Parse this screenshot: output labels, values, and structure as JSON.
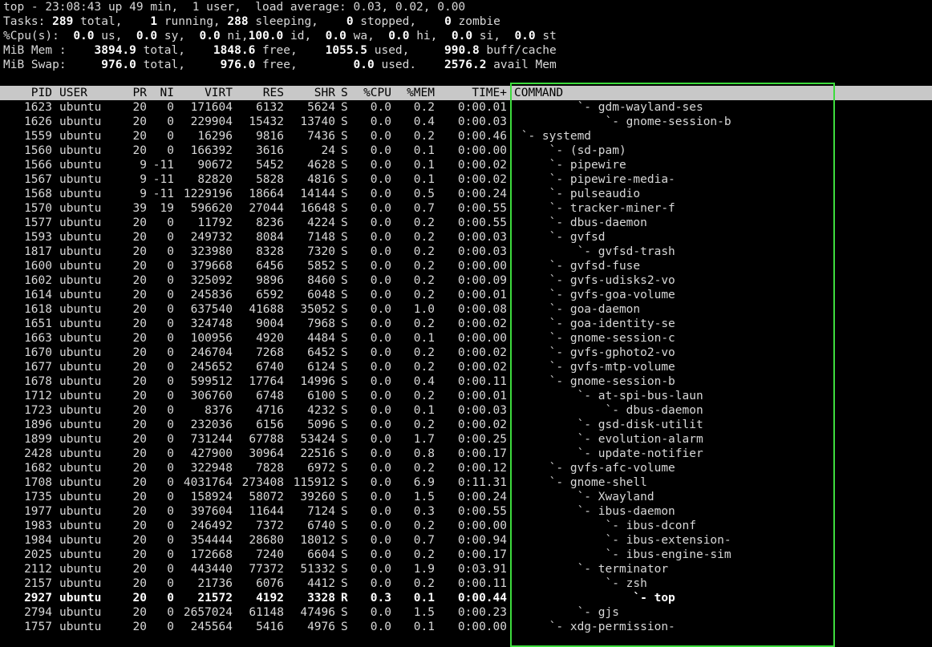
{
  "summary": {
    "top_line": "top - 23:08:43 up 49 min,  1 user,  load average: 0.03, 0.02, 0.00",
    "tasks": {
      "label": "Tasks:",
      "total": "289",
      "running": "1",
      "sleeping": "288",
      "stopped": "0",
      "zombie": "0"
    },
    "cpu": {
      "label": "%Cpu(s):",
      "us": "0.0",
      "sy": "0.0",
      "ni": "0.0",
      "id": "100.0",
      "wa": "0.0",
      "hi": "0.0",
      "si": "0.0",
      "st": "0.0"
    },
    "mem": {
      "label": "MiB Mem :",
      "total": "3894.9",
      "free": "1848.6",
      "used": "1055.5",
      "buff_cache": "990.8"
    },
    "swap": {
      "label": "MiB Swap:",
      "total": "976.0",
      "free": "976.0",
      "used": "0.0",
      "avail": "2576.2"
    }
  },
  "columns": {
    "pid": "PID",
    "user": "USER",
    "pr": "PR",
    "ni": "NI",
    "virt": "VIRT",
    "res": "RES",
    "shr": "SHR",
    "s": "S",
    "cpu": "%CPU",
    "mem": "%MEM",
    "time": "TIME+",
    "command": "COMMAND"
  },
  "processes": [
    {
      "pid": "1623",
      "user": "ubuntu",
      "pr": "20",
      "ni": "0",
      "virt": "171604",
      "res": "6132",
      "shr": "5624",
      "s": "S",
      "cpu": "0.0",
      "mem": "0.2",
      "time": "0:00.01",
      "command": "         `- gdm-wayland-ses"
    },
    {
      "pid": "1626",
      "user": "ubuntu",
      "pr": "20",
      "ni": "0",
      "virt": "229904",
      "res": "15432",
      "shr": "13740",
      "s": "S",
      "cpu": "0.0",
      "mem": "0.4",
      "time": "0:00.03",
      "command": "             `- gnome-session-b"
    },
    {
      "pid": "1559",
      "user": "ubuntu",
      "pr": "20",
      "ni": "0",
      "virt": "16296",
      "res": "9816",
      "shr": "7436",
      "s": "S",
      "cpu": "0.0",
      "mem": "0.2",
      "time": "0:00.46",
      "command": " `- systemd"
    },
    {
      "pid": "1560",
      "user": "ubuntu",
      "pr": "20",
      "ni": "0",
      "virt": "166392",
      "res": "3616",
      "shr": "24",
      "s": "S",
      "cpu": "0.0",
      "mem": "0.1",
      "time": "0:00.00",
      "command": "     `- (sd-pam)"
    },
    {
      "pid": "1566",
      "user": "ubuntu",
      "pr": "9",
      "ni": "-11",
      "virt": "90672",
      "res": "5452",
      "shr": "4628",
      "s": "S",
      "cpu": "0.0",
      "mem": "0.1",
      "time": "0:00.02",
      "command": "     `- pipewire"
    },
    {
      "pid": "1567",
      "user": "ubuntu",
      "pr": "9",
      "ni": "-11",
      "virt": "82820",
      "res": "5828",
      "shr": "4816",
      "s": "S",
      "cpu": "0.0",
      "mem": "0.1",
      "time": "0:00.02",
      "command": "     `- pipewire-media-"
    },
    {
      "pid": "1568",
      "user": "ubuntu",
      "pr": "9",
      "ni": "-11",
      "virt": "1229196",
      "res": "18664",
      "shr": "14144",
      "s": "S",
      "cpu": "0.0",
      "mem": "0.5",
      "time": "0:00.24",
      "command": "     `- pulseaudio"
    },
    {
      "pid": "1570",
      "user": "ubuntu",
      "pr": "39",
      "ni": "19",
      "virt": "596620",
      "res": "27044",
      "shr": "16648",
      "s": "S",
      "cpu": "0.0",
      "mem": "0.7",
      "time": "0:00.55",
      "command": "     `- tracker-miner-f"
    },
    {
      "pid": "1577",
      "user": "ubuntu",
      "pr": "20",
      "ni": "0",
      "virt": "11792",
      "res": "8236",
      "shr": "4224",
      "s": "S",
      "cpu": "0.0",
      "mem": "0.2",
      "time": "0:00.55",
      "command": "     `- dbus-daemon"
    },
    {
      "pid": "1593",
      "user": "ubuntu",
      "pr": "20",
      "ni": "0",
      "virt": "249732",
      "res": "8084",
      "shr": "7148",
      "s": "S",
      "cpu": "0.0",
      "mem": "0.2",
      "time": "0:00.03",
      "command": "     `- gvfsd"
    },
    {
      "pid": "1817",
      "user": "ubuntu",
      "pr": "20",
      "ni": "0",
      "virt": "323980",
      "res": "8328",
      "shr": "7320",
      "s": "S",
      "cpu": "0.0",
      "mem": "0.2",
      "time": "0:00.03",
      "command": "         `- gvfsd-trash"
    },
    {
      "pid": "1600",
      "user": "ubuntu",
      "pr": "20",
      "ni": "0",
      "virt": "379668",
      "res": "6456",
      "shr": "5852",
      "s": "S",
      "cpu": "0.0",
      "mem": "0.2",
      "time": "0:00.00",
      "command": "     `- gvfsd-fuse"
    },
    {
      "pid": "1602",
      "user": "ubuntu",
      "pr": "20",
      "ni": "0",
      "virt": "325092",
      "res": "9896",
      "shr": "8460",
      "s": "S",
      "cpu": "0.0",
      "mem": "0.2",
      "time": "0:00.09",
      "command": "     `- gvfs-udisks2-vo"
    },
    {
      "pid": "1614",
      "user": "ubuntu",
      "pr": "20",
      "ni": "0",
      "virt": "245836",
      "res": "6592",
      "shr": "6048",
      "s": "S",
      "cpu": "0.0",
      "mem": "0.2",
      "time": "0:00.01",
      "command": "     `- gvfs-goa-volume"
    },
    {
      "pid": "1618",
      "user": "ubuntu",
      "pr": "20",
      "ni": "0",
      "virt": "637540",
      "res": "41688",
      "shr": "35052",
      "s": "S",
      "cpu": "0.0",
      "mem": "1.0",
      "time": "0:00.08",
      "command": "     `- goa-daemon"
    },
    {
      "pid": "1651",
      "user": "ubuntu",
      "pr": "20",
      "ni": "0",
      "virt": "324748",
      "res": "9004",
      "shr": "7968",
      "s": "S",
      "cpu": "0.0",
      "mem": "0.2",
      "time": "0:00.02",
      "command": "     `- goa-identity-se"
    },
    {
      "pid": "1663",
      "user": "ubuntu",
      "pr": "20",
      "ni": "0",
      "virt": "100956",
      "res": "4920",
      "shr": "4484",
      "s": "S",
      "cpu": "0.0",
      "mem": "0.1",
      "time": "0:00.00",
      "command": "     `- gnome-session-c"
    },
    {
      "pid": "1670",
      "user": "ubuntu",
      "pr": "20",
      "ni": "0",
      "virt": "246704",
      "res": "7268",
      "shr": "6452",
      "s": "S",
      "cpu": "0.0",
      "mem": "0.2",
      "time": "0:00.02",
      "command": "     `- gvfs-gphoto2-vo"
    },
    {
      "pid": "1677",
      "user": "ubuntu",
      "pr": "20",
      "ni": "0",
      "virt": "245652",
      "res": "6740",
      "shr": "6124",
      "s": "S",
      "cpu": "0.0",
      "mem": "0.2",
      "time": "0:00.02",
      "command": "     `- gvfs-mtp-volume"
    },
    {
      "pid": "1678",
      "user": "ubuntu",
      "pr": "20",
      "ni": "0",
      "virt": "599512",
      "res": "17764",
      "shr": "14996",
      "s": "S",
      "cpu": "0.0",
      "mem": "0.4",
      "time": "0:00.11",
      "command": "     `- gnome-session-b"
    },
    {
      "pid": "1712",
      "user": "ubuntu",
      "pr": "20",
      "ni": "0",
      "virt": "306760",
      "res": "6748",
      "shr": "6100",
      "s": "S",
      "cpu": "0.0",
      "mem": "0.2",
      "time": "0:00.01",
      "command": "         `- at-spi-bus-laun"
    },
    {
      "pid": "1723",
      "user": "ubuntu",
      "pr": "20",
      "ni": "0",
      "virt": "8376",
      "res": "4716",
      "shr": "4232",
      "s": "S",
      "cpu": "0.0",
      "mem": "0.1",
      "time": "0:00.03",
      "command": "             `- dbus-daemon"
    },
    {
      "pid": "1896",
      "user": "ubuntu",
      "pr": "20",
      "ni": "0",
      "virt": "232036",
      "res": "6156",
      "shr": "5096",
      "s": "S",
      "cpu": "0.0",
      "mem": "0.2",
      "time": "0:00.02",
      "command": "         `- gsd-disk-utilit"
    },
    {
      "pid": "1899",
      "user": "ubuntu",
      "pr": "20",
      "ni": "0",
      "virt": "731244",
      "res": "67788",
      "shr": "53424",
      "s": "S",
      "cpu": "0.0",
      "mem": "1.7",
      "time": "0:00.25",
      "command": "         `- evolution-alarm"
    },
    {
      "pid": "2428",
      "user": "ubuntu",
      "pr": "20",
      "ni": "0",
      "virt": "427900",
      "res": "30964",
      "shr": "22516",
      "s": "S",
      "cpu": "0.0",
      "mem": "0.8",
      "time": "0:00.17",
      "command": "         `- update-notifier"
    },
    {
      "pid": "1682",
      "user": "ubuntu",
      "pr": "20",
      "ni": "0",
      "virt": "322948",
      "res": "7828",
      "shr": "6972",
      "s": "S",
      "cpu": "0.0",
      "mem": "0.2",
      "time": "0:00.12",
      "command": "     `- gvfs-afc-volume"
    },
    {
      "pid": "1708",
      "user": "ubuntu",
      "pr": "20",
      "ni": "0",
      "virt": "4031764",
      "res": "273408",
      "shr": "115912",
      "s": "S",
      "cpu": "0.0",
      "mem": "6.9",
      "time": "0:11.31",
      "command": "     `- gnome-shell"
    },
    {
      "pid": "1735",
      "user": "ubuntu",
      "pr": "20",
      "ni": "0",
      "virt": "158924",
      "res": "58072",
      "shr": "39260",
      "s": "S",
      "cpu": "0.0",
      "mem": "1.5",
      "time": "0:00.24",
      "command": "         `- Xwayland"
    },
    {
      "pid": "1977",
      "user": "ubuntu",
      "pr": "20",
      "ni": "0",
      "virt": "397604",
      "res": "11644",
      "shr": "7124",
      "s": "S",
      "cpu": "0.0",
      "mem": "0.3",
      "time": "0:00.55",
      "command": "         `- ibus-daemon"
    },
    {
      "pid": "1983",
      "user": "ubuntu",
      "pr": "20",
      "ni": "0",
      "virt": "246492",
      "res": "7372",
      "shr": "6740",
      "s": "S",
      "cpu": "0.0",
      "mem": "0.2",
      "time": "0:00.00",
      "command": "             `- ibus-dconf"
    },
    {
      "pid": "1984",
      "user": "ubuntu",
      "pr": "20",
      "ni": "0",
      "virt": "354444",
      "res": "28680",
      "shr": "18012",
      "s": "S",
      "cpu": "0.0",
      "mem": "0.7",
      "time": "0:00.94",
      "command": "             `- ibus-extension-"
    },
    {
      "pid": "2025",
      "user": "ubuntu",
      "pr": "20",
      "ni": "0",
      "virt": "172668",
      "res": "7240",
      "shr": "6604",
      "s": "S",
      "cpu": "0.0",
      "mem": "0.2",
      "time": "0:00.17",
      "command": "             `- ibus-engine-sim"
    },
    {
      "pid": "2112",
      "user": "ubuntu",
      "pr": "20",
      "ni": "0",
      "virt": "443440",
      "res": "77372",
      "shr": "51332",
      "s": "S",
      "cpu": "0.0",
      "mem": "1.9",
      "time": "0:03.91",
      "command": "         `- terminator"
    },
    {
      "pid": "2157",
      "user": "ubuntu",
      "pr": "20",
      "ni": "0",
      "virt": "21736",
      "res": "6076",
      "shr": "4412",
      "s": "S",
      "cpu": "0.0",
      "mem": "0.2",
      "time": "0:00.11",
      "command": "             `- zsh"
    },
    {
      "pid": "2927",
      "user": "ubuntu",
      "pr": "20",
      "ni": "0",
      "virt": "21572",
      "res": "4192",
      "shr": "3328",
      "s": "R",
      "cpu": "0.3",
      "mem": "0.1",
      "time": "0:00.44",
      "command": "                 `- top",
      "bold": true
    },
    {
      "pid": "2794",
      "user": "ubuntu",
      "pr": "20",
      "ni": "0",
      "virt": "2657024",
      "res": "61148",
      "shr": "47496",
      "s": "S",
      "cpu": "0.0",
      "mem": "1.5",
      "time": "0:00.23",
      "command": "         `- gjs"
    },
    {
      "pid": "1757",
      "user": "ubuntu",
      "pr": "20",
      "ni": "0",
      "virt": "245564",
      "res": "5416",
      "shr": "4976",
      "s": "S",
      "cpu": "0.0",
      "mem": "0.1",
      "time": "0:00.00",
      "command": "     `- xdg-permission-"
    }
  ],
  "colors": {
    "background": "#000000",
    "text": "#d8d8d8",
    "header_bg": "#c8c8c8",
    "highlight_box": "#3ddc3d"
  }
}
